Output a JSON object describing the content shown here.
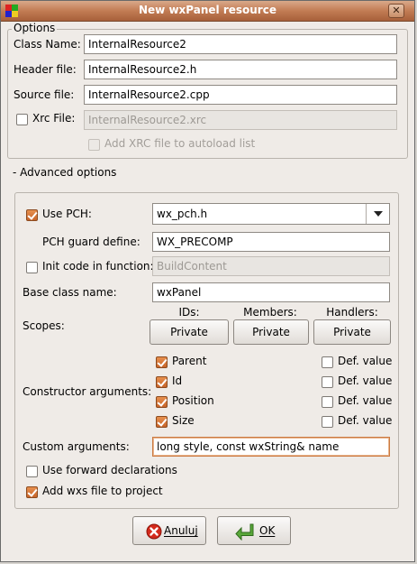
{
  "window": {
    "title": "New wxPanel resource"
  },
  "options": {
    "legend": "Options",
    "class_name": {
      "label": "Class Name:",
      "value": "InternalResource2"
    },
    "header_file": {
      "label": "Header file:",
      "value": "InternalResource2.h"
    },
    "source_file": {
      "label": "Source file:",
      "value": "InternalResource2.cpp"
    },
    "xrc_file": {
      "label": "Xrc File:",
      "value": "InternalResource2.xrc",
      "checked": false
    },
    "autoload": {
      "label": "Add XRC file to autoload list",
      "checked": false
    }
  },
  "advanced": {
    "toggle_label": "- Advanced options",
    "use_pch": {
      "label": "Use PCH:",
      "checked": true,
      "value": "wx_pch.h"
    },
    "pch_guard": {
      "label": "PCH guard define:",
      "value": "WX_PRECOMP"
    },
    "init_code": {
      "label": "Init code in function:",
      "value": "BuildContent",
      "checked": false
    },
    "base_class": {
      "label": "Base class name:",
      "value": "wxPanel"
    },
    "scopes": {
      "label": "Scopes:",
      "ids": {
        "header": "IDs:",
        "value": "Private"
      },
      "members": {
        "header": "Members:",
        "value": "Private"
      },
      "handlers": {
        "header": "Handlers:",
        "value": "Private"
      }
    },
    "constructor": {
      "label": "Constructor arguments:",
      "args": [
        {
          "name": "Parent",
          "checked": true,
          "def_label": "Def. value",
          "def_checked": false
        },
        {
          "name": "Id",
          "checked": true,
          "def_label": "Def. value",
          "def_checked": false
        },
        {
          "name": "Position",
          "checked": true,
          "def_label": "Def. value",
          "def_checked": false
        },
        {
          "name": "Size",
          "checked": true,
          "def_label": "Def. value",
          "def_checked": false
        }
      ]
    },
    "custom_args": {
      "label": "Custom arguments:",
      "value": "long style, const wxString& name"
    },
    "forward_decl": {
      "label": "Use forward declarations",
      "checked": false
    },
    "add_wxs": {
      "label": "Add wxs file to project",
      "checked": true
    }
  },
  "buttons": {
    "cancel": {
      "label": "Anuluj"
    },
    "ok": {
      "label": "OK"
    }
  },
  "colors": {
    "accent": "#cc7b42",
    "titlebar": "#c27c54"
  }
}
